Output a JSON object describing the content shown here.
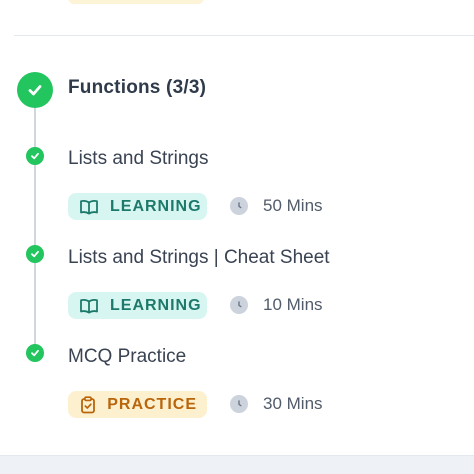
{
  "section": {
    "title": "Functions (3/3)",
    "status_icon": "check-circle-icon"
  },
  "items": [
    {
      "title": "Lists and Strings",
      "badge_label": "LEARNING",
      "badge_icon": "book-open-icon",
      "duration": "50 Mins"
    },
    {
      "title": "Lists and Strings | Cheat Sheet",
      "badge_label": "LEARNING",
      "badge_icon": "book-open-icon",
      "duration": "10 Mins"
    },
    {
      "title": "MCQ Practice",
      "badge_label": "PRACTICE",
      "badge_icon": "clipboard-check-icon",
      "duration": "30 Mins"
    }
  ],
  "colors": {
    "complete_green": "#22c55e",
    "learning_bg": "#d8f6f1",
    "learning_text": "#1d7a6b",
    "practice_bg": "#fdf0cf",
    "practice_text": "#b8650c"
  }
}
